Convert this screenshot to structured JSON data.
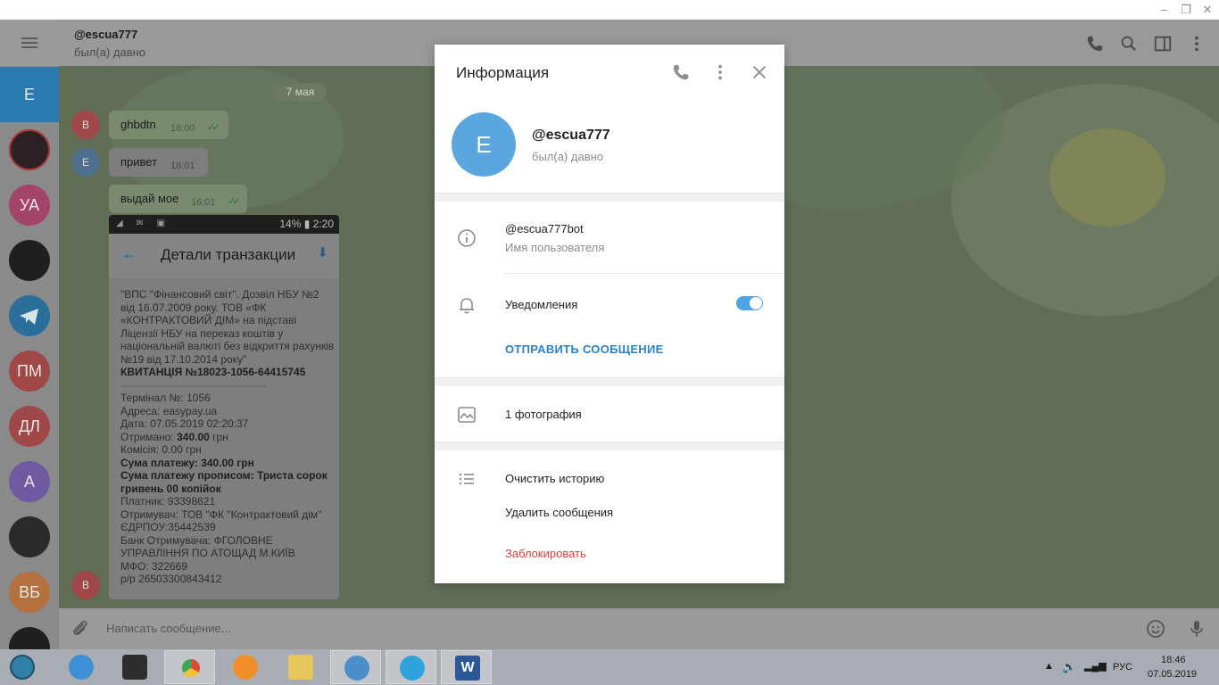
{
  "chat": {
    "title": "@escua777",
    "status": "был(а) давно",
    "date": "7 мая",
    "messages": [
      {
        "avatar": "В",
        "text": "ghbdtn",
        "time": "16:00"
      },
      {
        "avatar": "E",
        "text": "привет",
        "time": "16:01"
      },
      {
        "avatar": "",
        "text": "выдай мое",
        "time": "16:01"
      }
    ],
    "last_avatar": "В"
  },
  "sidebar": {
    "items": [
      {
        "initials": "E",
        "color": "#2a7ab0"
      },
      {
        "initials": "",
        "color": "#3a2a2a"
      },
      {
        "initials": "УА",
        "color": "#a3446a"
      },
      {
        "initials": "",
        "color": "#1f1f1f"
      },
      {
        "initials": "",
        "color": "#2a6f9a"
      },
      {
        "initials": "ПМ",
        "color": "#a04848"
      },
      {
        "initials": "ДЛ",
        "color": "#a04848"
      },
      {
        "initials": "А",
        "color": "#6d5aa0"
      },
      {
        "initials": "",
        "color": "#2a2a2a"
      },
      {
        "initials": "ВБ",
        "color": "#b4703e"
      },
      {
        "initials": "",
        "color": "#1f1f1f"
      }
    ]
  },
  "receipt": {
    "status_text": "14% ▮ 2:20",
    "title": "Детали транзакции",
    "lines": [
      "\"ВПС \"Фінансовий світ\". Дозвіл НБУ №2 від 16.07.2009 року. ТОВ «ФК «КОНТРАКТОВИЙ ДІМ» на підставі Ліцензії НБУ на переказ коштів у національній валюті без відкриття рахунків №19 від 17.10.2014 року\""
    ],
    "receipt_no": "КВИТАНЦІЯ №18023-1056-64415745",
    "separator": "-----------------------------------------",
    "details": [
      "Термінал №: 1056",
      "Адреса: easypay.ua",
      "Дата: 07.05.2019 02:20:37"
    ],
    "received_label": "Отримано: ",
    "received_value": "340.00",
    "received_unit": " грн",
    "commission": "Комісія: 0.00 грн",
    "sum": "Сума платежу: 340.00 грн",
    "sum_words": "Сума платежу прописом: Триста сорок гривень 00 копійок",
    "payer": "Платник: 93398621",
    "recipient": "Отримувач: ТОВ \"ФК \"Контрактовий дім\"",
    "edrpou": "ЄДРПОУ:35442539",
    "bank": "Банк Отримувача: ФГОЛОВНЕ УПРАВЛІННЯ ПО АТОЩАД М.КИЇВ",
    "mfo": "МФО: 322669",
    "account": "р/р 26503300843412"
  },
  "composer": {
    "placeholder": "Написать сообщение..."
  },
  "modal": {
    "title": "Информация",
    "avatar": "E",
    "name": "@escua777",
    "last_seen": "был(а) давно",
    "username_value": "@escua777bot",
    "username_label": "Имя пользователя",
    "notifications_label": "Уведомления",
    "notifications_on": true,
    "send_message": "ОТПРАВИТЬ СООБЩЕНИЕ",
    "photos": "1 фотография",
    "clear_history": "Очистить историю",
    "delete_messages": "Удалить сообщения",
    "block": "Заблокировать"
  },
  "taskbar": {
    "lang": "РУС",
    "time": "18:46",
    "date": "07.05.2019"
  }
}
